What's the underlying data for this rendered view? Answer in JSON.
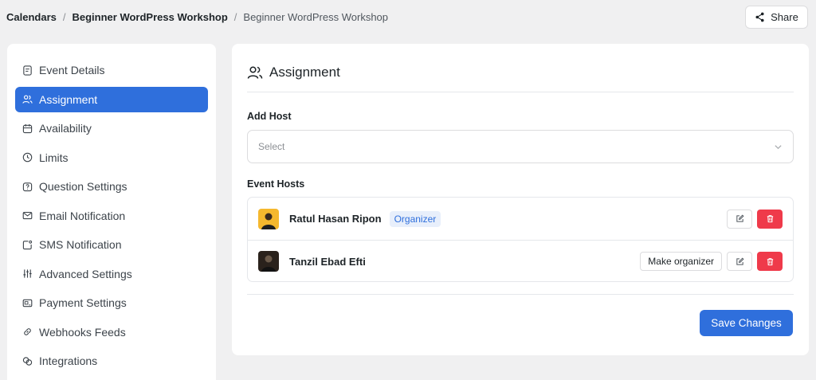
{
  "breadcrumb": {
    "root": "Calendars",
    "parent": "Beginner WordPress Workshop",
    "current": "Beginner WordPress Workshop",
    "separator": "/"
  },
  "share": {
    "label": "Share",
    "icon": "share-icon"
  },
  "sidebar": {
    "items": [
      {
        "label": "Event Details",
        "icon": "document-icon"
      },
      {
        "label": "Assignment",
        "icon": "users-icon",
        "active": true
      },
      {
        "label": "Availability",
        "icon": "calendar-icon"
      },
      {
        "label": "Limits",
        "icon": "clock-icon"
      },
      {
        "label": "Question Settings",
        "icon": "question-icon"
      },
      {
        "label": "Email Notification",
        "icon": "mail-icon"
      },
      {
        "label": "SMS Notification",
        "icon": "sms-icon"
      },
      {
        "label": "Advanced Settings",
        "icon": "sliders-icon"
      },
      {
        "label": "Payment Settings",
        "icon": "payment-icon"
      },
      {
        "label": "Webhooks Feeds",
        "icon": "link-icon"
      },
      {
        "label": "Integrations",
        "icon": "integrations-icon"
      }
    ]
  },
  "main": {
    "title": "Assignment",
    "add_host": {
      "label": "Add Host",
      "placeholder": "Select"
    },
    "event_hosts": {
      "label": "Event Hosts",
      "hosts": [
        {
          "name": "Ratul Hasan Ripon",
          "badge": "Organizer"
        },
        {
          "name": "Tanzil Ebad Efti",
          "make_organizer": "Make organizer"
        }
      ]
    },
    "save_label": "Save Changes"
  },
  "colors": {
    "accent": "#2f6fdc",
    "danger": "#ef3a4a",
    "background": "#f0f0f1"
  }
}
